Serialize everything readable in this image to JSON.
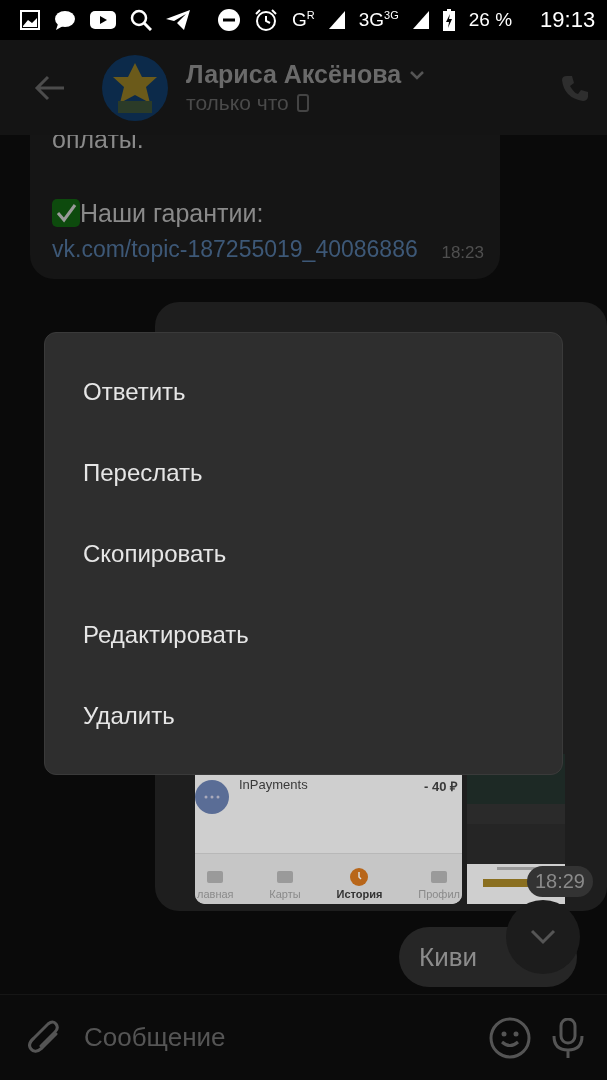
{
  "status_bar": {
    "network": [
      "G$^{R}$",
      "3G$^{3G}$"
    ],
    "battery": "26 %",
    "time": "19:13"
  },
  "header": {
    "name": "Лариса Аксёнова",
    "status": "только что"
  },
  "messages": [
    {
      "kind": "text",
      "outgoing": false,
      "text": "оплаты.",
      "guarantee": "Наши гарантии: ",
      "link": "vk.com/topic-187255019_40086886",
      "time": "18:23"
    },
    {
      "outgoing": true,
      "rows": [
        {
          "title": "InPayments",
          "amount": "- 40 ₽"
        }
      ],
      "tabs": [
        {
          "label": "лавная",
          "selected": false
        },
        {
          "label": "Карты",
          "selected": false
        },
        {
          "label": "История",
          "selected": true
        },
        {
          "label": "Профил",
          "selected": false
        }
      ],
      "time": "18:29"
    },
    {
      "kind": "text",
      "outgoing": true,
      "text": "Киви"
    }
  ],
  "menu": {
    "items": [
      "Ответить",
      "Переслать",
      "Скопировать",
      "Редактировать",
      "Удалить"
    ]
  },
  "composer": {
    "placeholder": "Сообщение"
  }
}
